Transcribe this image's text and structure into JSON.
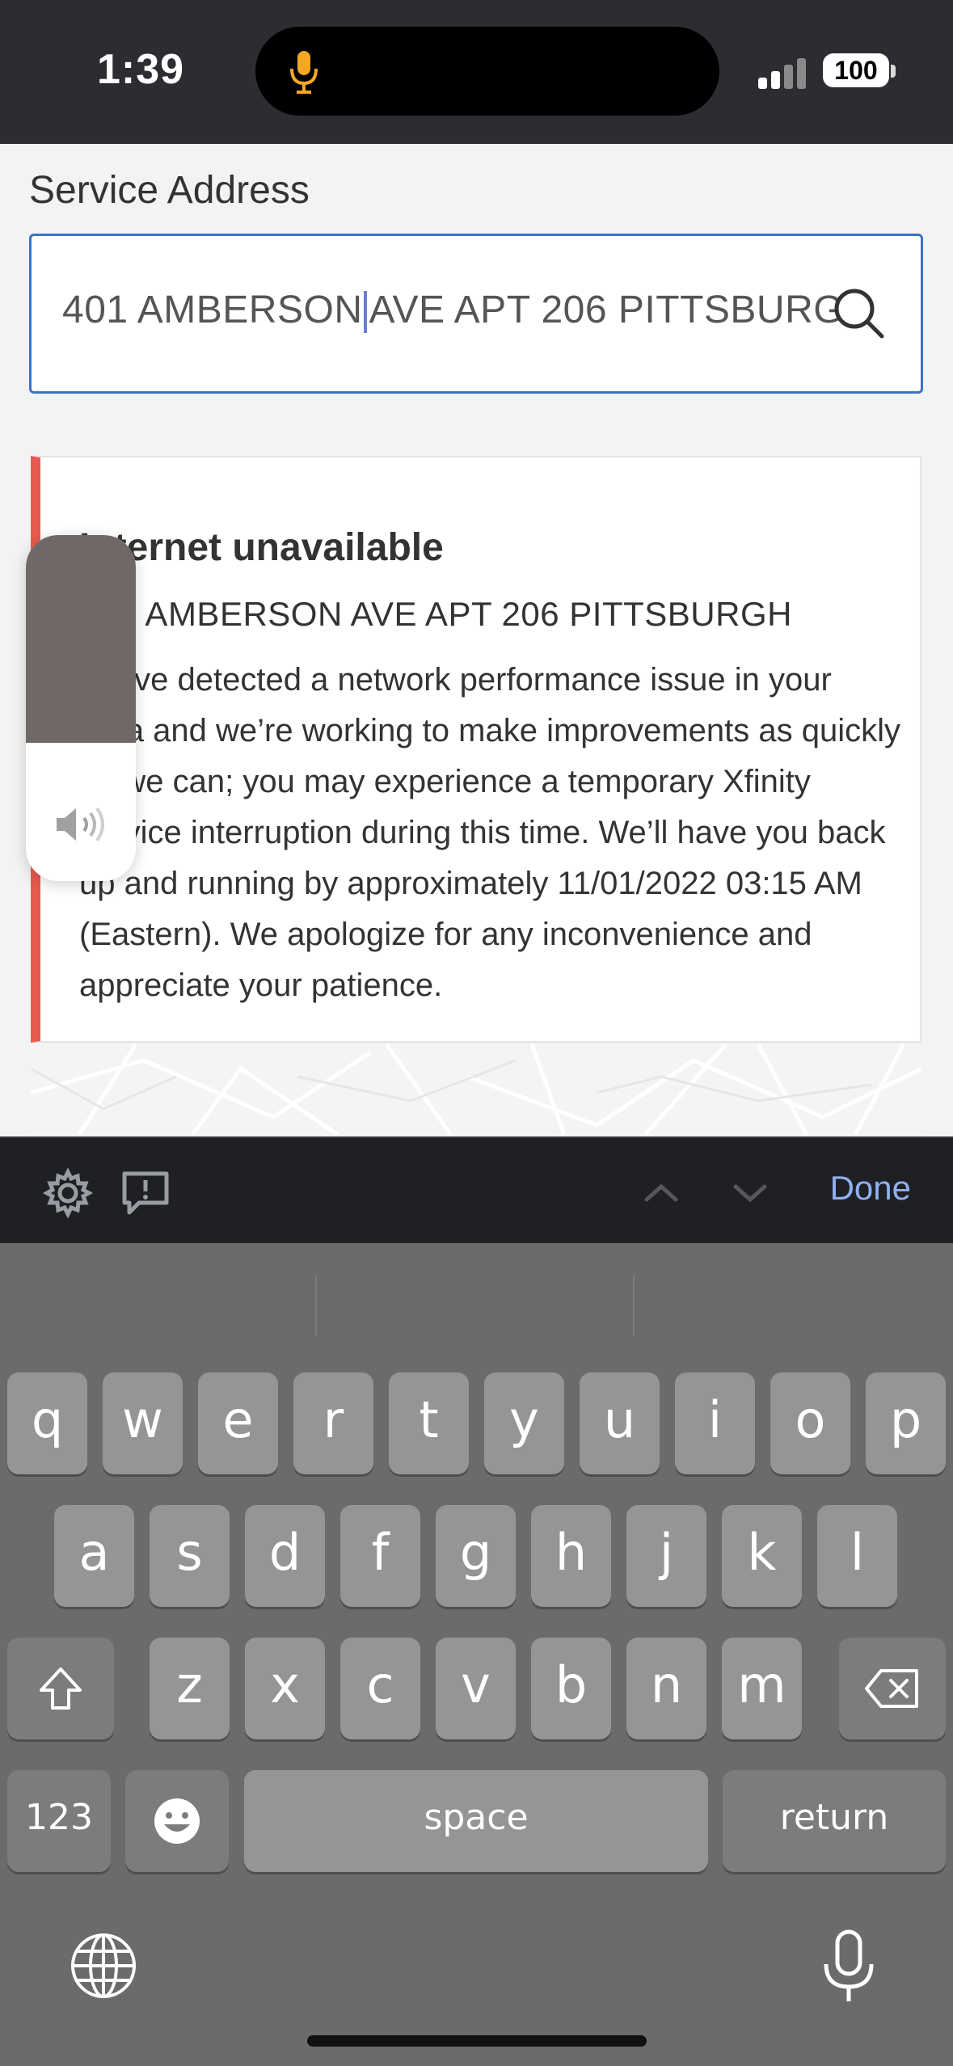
{
  "status_bar": {
    "time": "1:39",
    "battery": "100",
    "colors": {
      "mic_indicator": "#f5a623"
    }
  },
  "form": {
    "label": "Service Address",
    "address_value_before_cursor": "401 AMBERSON",
    "address_value_after_cursor": "AVE APT 206 PITTSBURGH",
    "search_icon": "search-icon"
  },
  "alert": {
    "title": "Internet unavailable",
    "address": "401 AMBERSON AVE APT 206 PITTSBURGH",
    "body": "We’ve detected a network performance issue in your area and we’re working to make improvements as quickly as we can; you may experience a temporary Xfinity service interruption during this time. We’ll have you back up and running by approximately 11/01/2022 03:15 AM (Eastern). We apologize for any inconvenience and appreciate your patience.",
    "accent_color": "#e85a4f"
  },
  "volume_hud": {
    "level": 0.6
  },
  "toolbar": {
    "done_label": "Done",
    "icons": [
      "gear-icon",
      "feedback-icon",
      "chevron-up-icon",
      "chevron-down-icon"
    ]
  },
  "keyboard": {
    "row1": [
      "q",
      "w",
      "e",
      "r",
      "t",
      "y",
      "u",
      "i",
      "o",
      "p"
    ],
    "row2": [
      "a",
      "s",
      "d",
      "f",
      "g",
      "h",
      "j",
      "k",
      "l"
    ],
    "row3": [
      "z",
      "x",
      "c",
      "v",
      "b",
      "n",
      "m"
    ],
    "numbers_label": "123",
    "space_label": "space",
    "return_label": "return"
  }
}
